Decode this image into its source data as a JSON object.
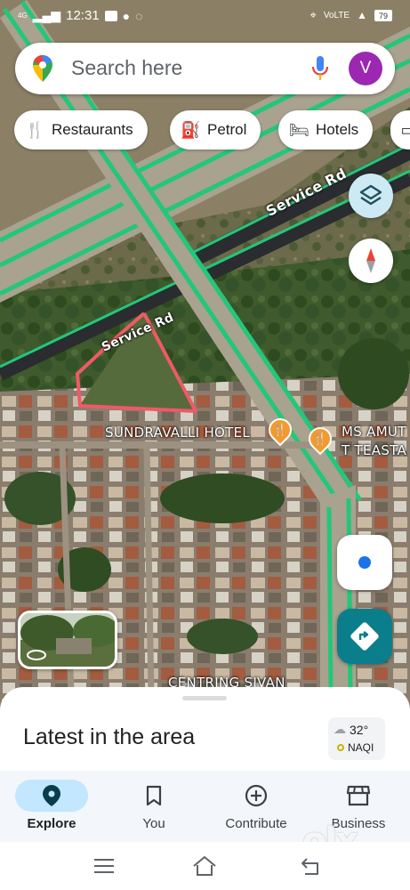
{
  "status_bar": {
    "network": "4G",
    "time": "12:31",
    "battery": "79",
    "volte": "VoLTE"
  },
  "search": {
    "placeholder": "Search here",
    "avatar_initial": "V",
    "icons": [
      "maps-pin-icon",
      "microphone-icon"
    ]
  },
  "chips": [
    {
      "label": "Restaurants",
      "icon": "fork-knife-icon"
    },
    {
      "label": "Petrol",
      "icon": "fuel-pump-icon"
    },
    {
      "label": "Hotels",
      "icon": "bed-icon"
    }
  ],
  "map": {
    "road_labels": [
      "Service Rd",
      "Service Rd"
    ],
    "places": [
      "SUNDRAVALLI HOTEL",
      "MS AMUT",
      "T TEASTA",
      "CENTRING SIVAN"
    ]
  },
  "bottom_sheet": {
    "title": "Latest in the area",
    "weather": {
      "temperature": "32°",
      "air_quality": "NAQI"
    }
  },
  "nav": [
    {
      "label": "Explore",
      "active": true
    },
    {
      "label": "You",
      "active": false
    },
    {
      "label": "Contribute",
      "active": false
    },
    {
      "label": "Business",
      "active": false
    }
  ],
  "watermark": "olx",
  "colors": {
    "road_green": "#22c77a",
    "accent_blue": "#1a73e8",
    "avatar_purple": "#9c27b0",
    "directions_teal": "#0b7e8c",
    "boundary_red": "#ee5a66",
    "poi_orange": "#f29a2e"
  }
}
